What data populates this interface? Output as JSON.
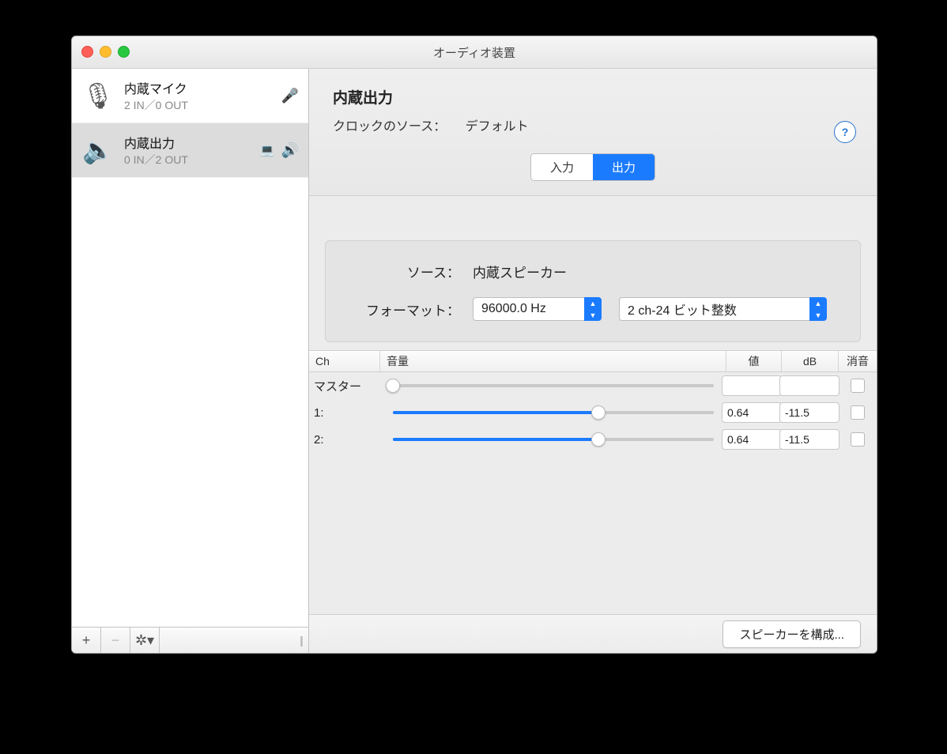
{
  "window": {
    "title": "オーディオ装置"
  },
  "sidebar": {
    "devices": [
      {
        "name": "内蔵マイク",
        "io": "2 IN／0 OUT",
        "icon": "microphone",
        "default_in": true,
        "selected": false
      },
      {
        "name": "内蔵出力",
        "io": "0 IN／2 OUT",
        "icon": "speaker",
        "default_out": true,
        "system_out": true,
        "selected": true
      }
    ],
    "footer": {
      "add": "+",
      "remove": "−",
      "gear": "✱"
    }
  },
  "detail": {
    "title": "内蔵出力",
    "clock_label": "クロックのソース：",
    "clock_value": "デフォルト",
    "tabs": {
      "input": "入力",
      "output": "出力",
      "active": "output"
    },
    "source_label": "ソース：",
    "source_value": "内蔵スピーカー",
    "format_label": "フォーマット：",
    "format_rate": "96000.0 Hz",
    "format_bits": "2 ch-24 ビット整数",
    "columns": {
      "ch": "Ch",
      "vol": "音量",
      "value": "値",
      "db": "dB",
      "mute": "消音"
    },
    "channels": [
      {
        "label": "マスター",
        "pos": 0.0,
        "value": "",
        "db": "",
        "mute": false,
        "filled": false
      },
      {
        "label": "1:",
        "pos": 0.64,
        "value": "0.64",
        "db": "-11.5",
        "mute": false,
        "filled": true
      },
      {
        "label": "2:",
        "pos": 0.64,
        "value": "0.64",
        "db": "-11.5",
        "mute": false,
        "filled": true
      }
    ],
    "configure_btn": "スピーカーを構成..."
  }
}
